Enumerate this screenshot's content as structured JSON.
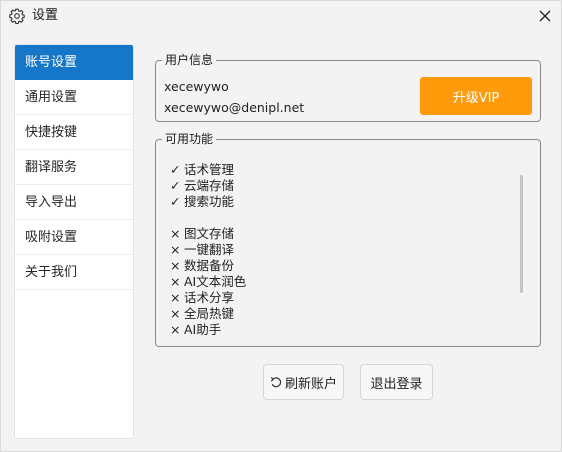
{
  "window": {
    "title": "设置"
  },
  "sidebar": {
    "items": [
      {
        "label": "账号设置",
        "active": true
      },
      {
        "label": "通用设置"
      },
      {
        "label": "快捷按键"
      },
      {
        "label": "翻译服务"
      },
      {
        "label": "导入导出"
      },
      {
        "label": "吸附设置"
      },
      {
        "label": "关于我们"
      }
    ]
  },
  "user_info": {
    "legend": "用户信息",
    "username": "xecewywo",
    "email": "xecewywo@denipl.net",
    "vip_label": "升级VIP"
  },
  "features": {
    "legend": "可用功能",
    "enabled": [
      {
        "mark": "✓",
        "label": "话术管理"
      },
      {
        "mark": "✓",
        "label": "云端存储"
      },
      {
        "mark": "✓",
        "label": "搜索功能"
      }
    ],
    "disabled": [
      {
        "mark": "×",
        "label": "图文存储"
      },
      {
        "mark": "×",
        "label": "一键翻译"
      },
      {
        "mark": "×",
        "label": "数据备份"
      },
      {
        "mark": "×",
        "label": "AI文本润色"
      },
      {
        "mark": "×",
        "label": "话术分享"
      },
      {
        "mark": "×",
        "label": "全局热键"
      },
      {
        "mark": "×",
        "label": "AI助手"
      }
    ]
  },
  "actions": {
    "refresh_label": "刷新账户",
    "logout_label": "退出登录"
  },
  "colors": {
    "accent": "#1677c9",
    "vip": "#ff9a0a"
  },
  "icons": {
    "title": "gear-icon",
    "close": "close-icon",
    "refresh": "refresh-icon"
  }
}
